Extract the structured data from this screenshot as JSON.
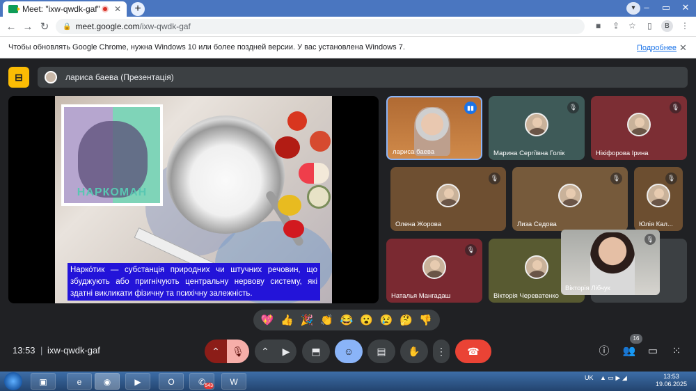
{
  "browser": {
    "tab_title": "Meet: \"ixw-qwdk-gaf\"",
    "tab_close": "✕",
    "new_tab": "+",
    "url_host": "meet.google.com",
    "url_path": "/ixw-qwdk-gaf",
    "profile_initial": "B",
    "info_message": "Чтобы обновлять Google Chrome, нужна Windows 10 или более поздней версии. У вас установлена Windows 7.",
    "info_link": "Подробнее",
    "info_close": "✕"
  },
  "meet": {
    "presenter_label": "лариса баева (Презентація)",
    "slide": {
      "poster_caption": "НАРКОМАН",
      "caption_text": "Наркóтик — субстанція природних чи штучних речовин, що збуджують або пригнічують центральну нервову систему, які здатні викликати фізичну та психічну залежність."
    },
    "participants": [
      {
        "name": "лариса баева",
        "status": "speaking"
      },
      {
        "name": "Марина Сергіївна Голік",
        "status": "muted"
      },
      {
        "name": "Нікіфорова Ірина",
        "status": "muted"
      },
      {
        "name": "Олена Жорова",
        "status": "muted"
      },
      {
        "name": "Лиза Седова",
        "status": "muted"
      },
      {
        "name": "Юлія Кал...",
        "status": "muted"
      },
      {
        "name": "Наталья Мангадаш",
        "status": "muted"
      },
      {
        "name": "Вікторія Череватенко",
        "status": "muted"
      },
      {
        "name": "Вікторія Лібчук",
        "status": "muted"
      }
    ],
    "reactions": [
      "💖",
      "👍",
      "🎉",
      "👏",
      "😂",
      "😮",
      "😢",
      "🤔",
      "👎"
    ],
    "time": "13:53",
    "separator": "|",
    "meeting_code": "ixw-qwdk-gaf",
    "people_count": "16"
  },
  "taskbar": {
    "viber_badge": "543",
    "lang": "UK",
    "time": "13:53",
    "date": "19.06.2025"
  },
  "colors": {
    "meet_bg": "#202124",
    "end_call": "#ea4335",
    "mic_off": "#8c1d18",
    "caption_bg": "#2314d9",
    "active_btn": "#8ab4f8"
  }
}
